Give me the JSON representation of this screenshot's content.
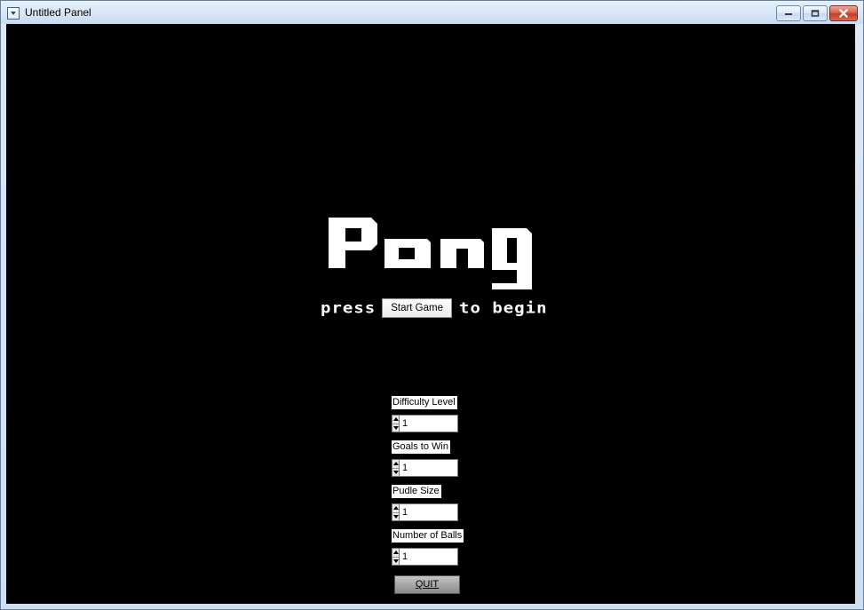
{
  "window": {
    "title": "Untitled Panel",
    "icon": "panel-icon",
    "controls": [
      "minimize-icon",
      "restore-icon",
      "close-icon"
    ]
  },
  "game": {
    "title": "Pong",
    "tagline_prefix": "press",
    "start_button_label": "Start Game",
    "tagline_suffix": "to begin"
  },
  "settings": [
    {
      "label": "Difficulty Level",
      "value": "1"
    },
    {
      "label": "Goals to Win",
      "value": "1"
    },
    {
      "label": "Pudle Size",
      "value": "1"
    },
    {
      "label": "Number of Balls",
      "value": "1"
    }
  ],
  "quit_button_label": "QUIT",
  "colors": {
    "background": "#000000",
    "text": "#ffffff",
    "title_bar": "#d7e6f7",
    "close_button": "#c94a31"
  }
}
